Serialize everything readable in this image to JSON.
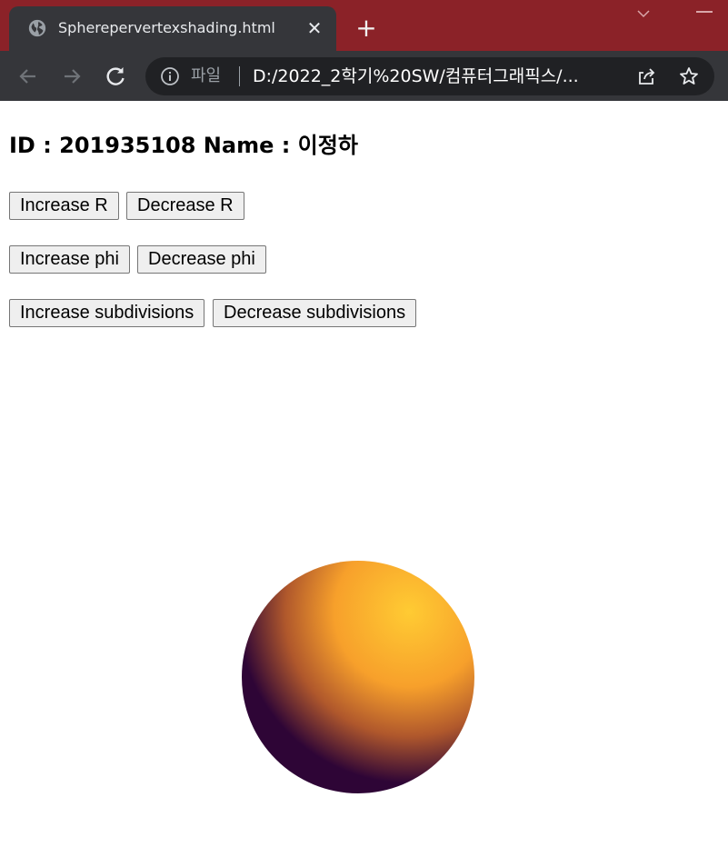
{
  "browser": {
    "tab_title": "Spherepervertexshading.html",
    "close_glyph": "✕",
    "new_tab_glyph": "+",
    "scheme_label": "파일",
    "url": "D:/2022_2학기%20SW/컴퓨터그래픽스/...",
    "icons": [
      "globe-icon",
      "close-icon",
      "plus-icon",
      "chevron-down-icon",
      "minimize-icon",
      "back-arrow-icon",
      "forward-arrow-icon",
      "reload-icon",
      "info-icon",
      "share-icon",
      "star-icon"
    ]
  },
  "page": {
    "heading": "ID : 201935108 Name : 이정하",
    "buttons": {
      "increase_r": "Increase R",
      "decrease_r": "Decrease R",
      "increase_phi": "Increase phi",
      "decrease_phi": "Decrease phi",
      "increase_subdivisions": "Increase subdivisions",
      "decrease_subdivisions": "Decrease subdivisions"
    },
    "sphere": {
      "highlight_color": "#ffcb33",
      "mid_color": "#f7a02b",
      "shadow_color": "#2e0536"
    }
  },
  "colors": {
    "titlebar": "#8b2228",
    "tab": "#35363a",
    "omnibox": "#202124"
  }
}
